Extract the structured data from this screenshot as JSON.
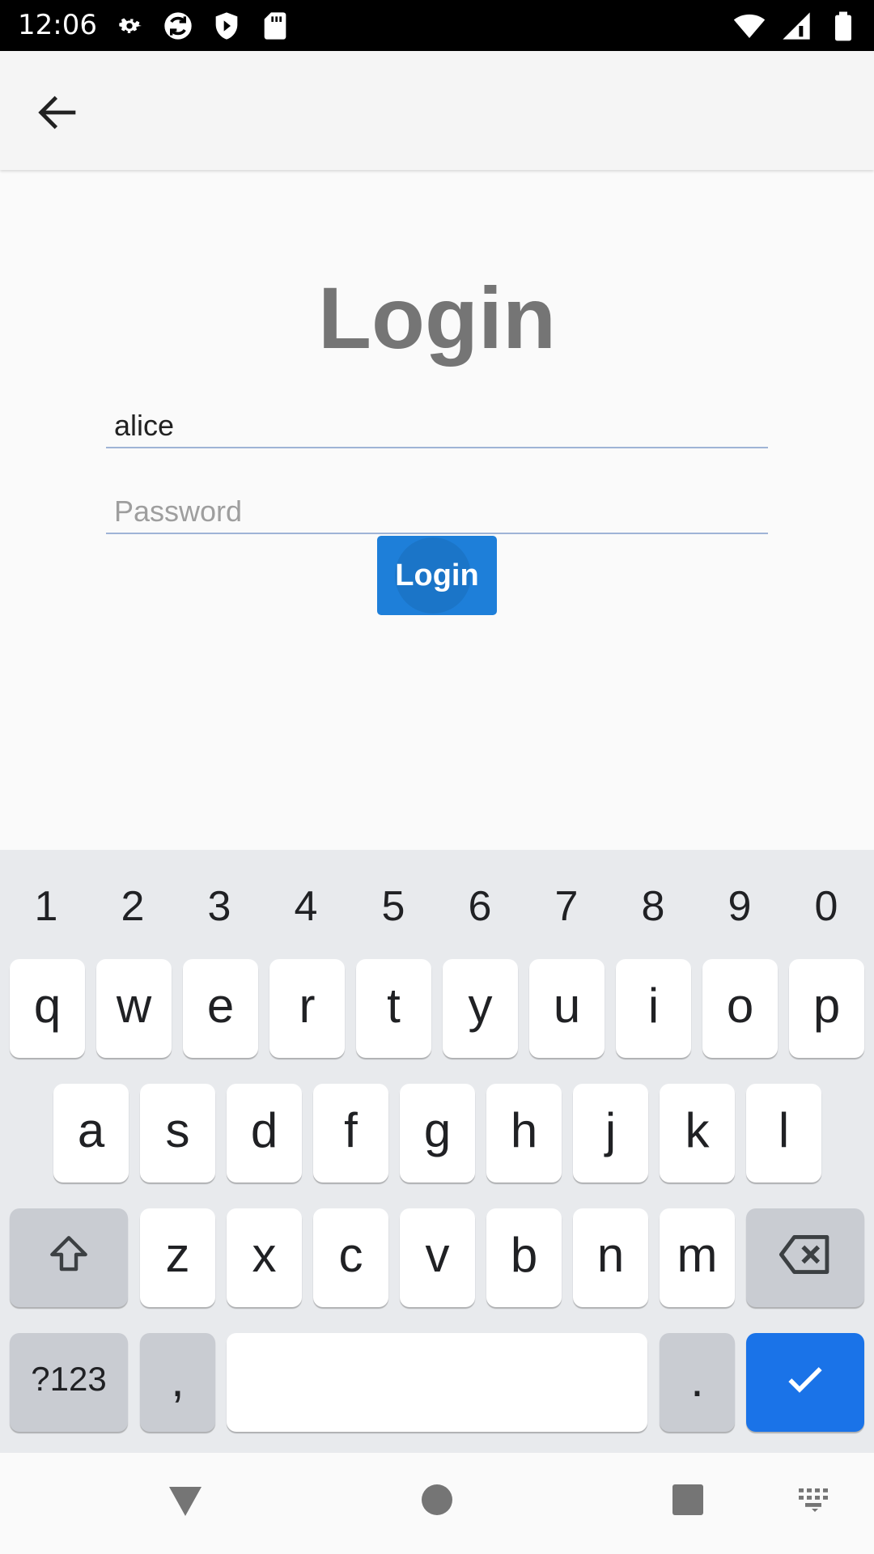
{
  "status_bar": {
    "time": "12:06",
    "left_icons": [
      "gear-icon",
      "sync-icon",
      "play-protect-icon",
      "sd-card-icon"
    ],
    "right_icons": [
      "wifi-icon",
      "cell-signal-icon",
      "battery-icon"
    ]
  },
  "app_bar": {
    "back_icon": "arrow-back-icon"
  },
  "login": {
    "title": "Login",
    "username_value": "alice",
    "password_placeholder": "Password",
    "button_label": "Login"
  },
  "keyboard": {
    "number_row": [
      "1",
      "2",
      "3",
      "4",
      "5",
      "6",
      "7",
      "8",
      "9",
      "0"
    ],
    "row1": [
      "q",
      "w",
      "e",
      "r",
      "t",
      "y",
      "u",
      "i",
      "o",
      "p"
    ],
    "row2": [
      "a",
      "s",
      "d",
      "f",
      "g",
      "h",
      "j",
      "k",
      "l"
    ],
    "row3": [
      "z",
      "x",
      "c",
      "v",
      "b",
      "n",
      "m"
    ],
    "symbols_label": "?123",
    "comma_label": ",",
    "period_label": ".",
    "shift_icon": "shift-icon",
    "backspace_icon": "backspace-icon",
    "enter_icon": "checkmark-icon",
    "accent_color": "#1a73e8"
  },
  "nav_bar": {
    "icons": [
      "back-triangle-icon",
      "home-circle-icon",
      "recents-square-icon",
      "keyboard-switch-icon"
    ]
  }
}
